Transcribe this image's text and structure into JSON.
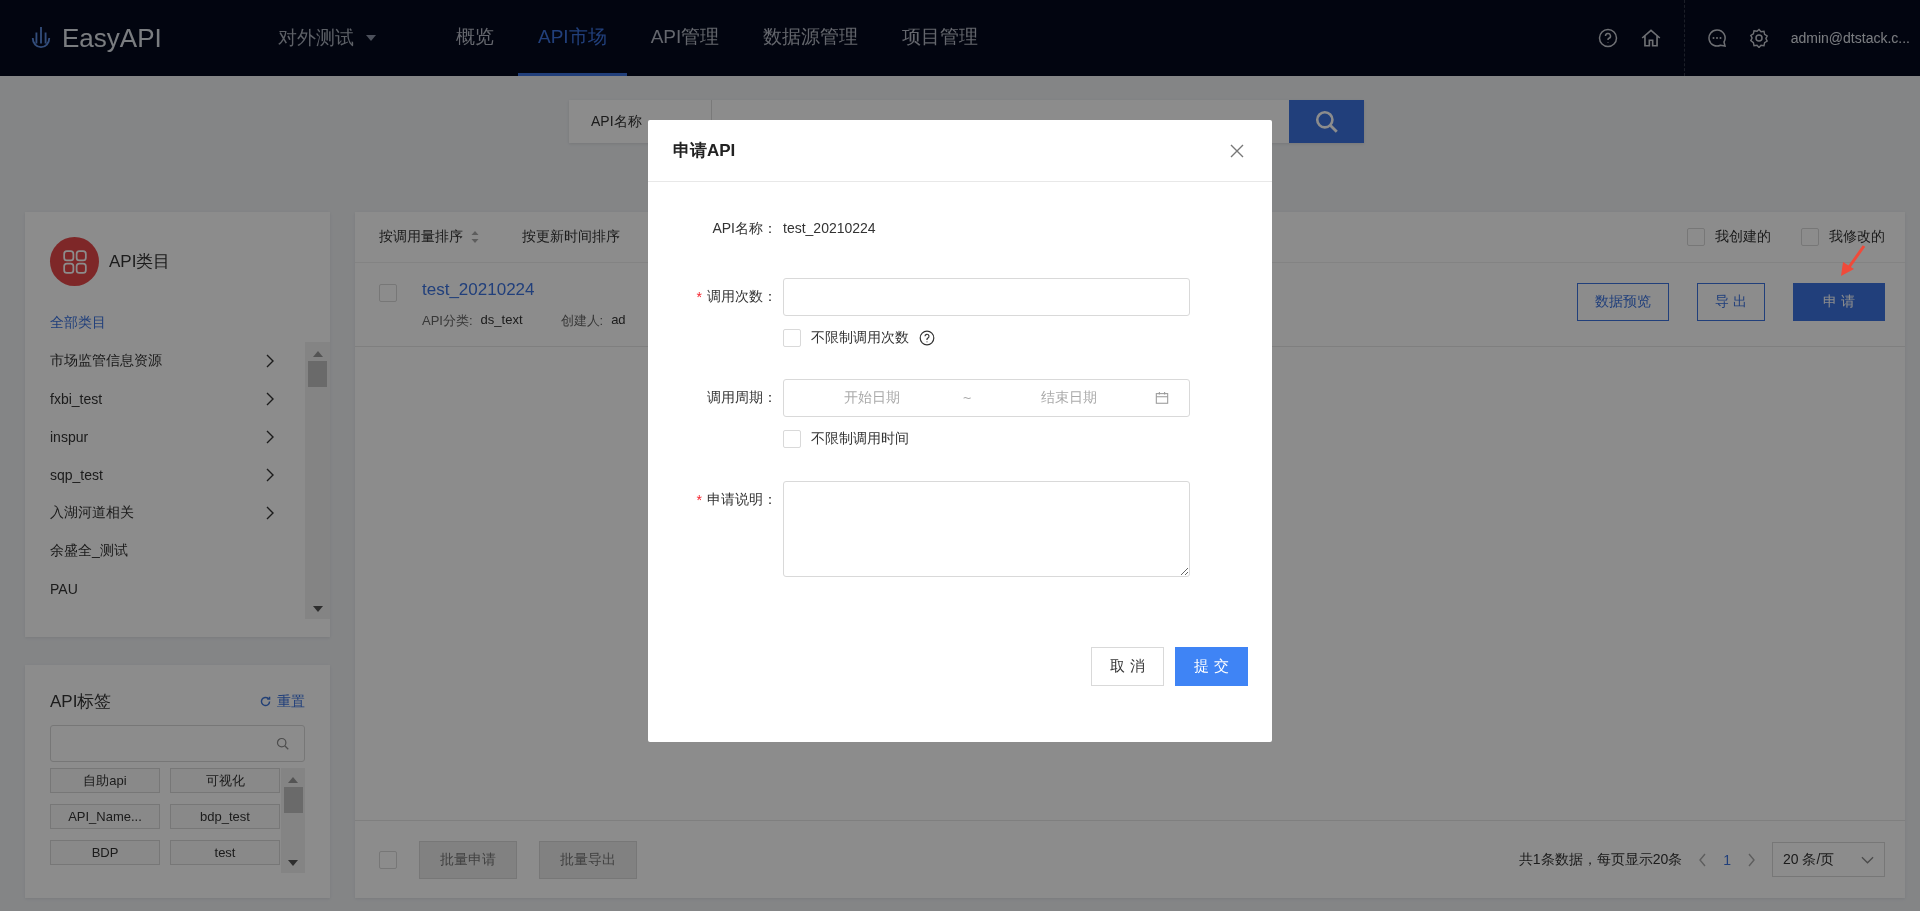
{
  "header": {
    "logo": "EasyAPI",
    "project": "对外测试",
    "project_expanded": false,
    "nav": [
      {
        "label": "概览",
        "selected": false
      },
      {
        "label": "API市场",
        "selected": true
      },
      {
        "label": "API管理",
        "selected": false
      },
      {
        "label": "数据源管理",
        "selected": false
      },
      {
        "label": "项目管理",
        "selected": false
      }
    ],
    "user": "admin@dtstack.c..."
  },
  "search": {
    "field_label": "API名称"
  },
  "categories": {
    "title": "API类目",
    "items": [
      {
        "label": "全部类目",
        "selected": true,
        "has_children": false
      },
      {
        "label": "市场监管信息资源",
        "selected": false,
        "has_children": true
      },
      {
        "label": "fxbi_test",
        "selected": false,
        "has_children": true
      },
      {
        "label": "inspur",
        "selected": false,
        "has_children": true
      },
      {
        "label": "sqp_test",
        "selected": false,
        "has_children": true
      },
      {
        "label": "入湖河道相关",
        "selected": false,
        "has_children": true
      },
      {
        "label": "余盛全_测试",
        "selected": false,
        "has_children": false
      },
      {
        "label": "PAU",
        "selected": false,
        "has_children": false
      }
    ]
  },
  "tags": {
    "title": "API标签",
    "reset": "重置",
    "items": [
      "自助api",
      "可视化",
      "API_Name...",
      "bdp_test",
      "BDP",
      "test"
    ]
  },
  "sort_options": [
    {
      "label": "按调用量排序",
      "sortable": true
    },
    {
      "label": "按更新时间排序",
      "sortable": false
    }
  ],
  "filters": [
    {
      "label": "我创建的",
      "checked": false
    },
    {
      "label": "我修改的",
      "checked": false
    }
  ],
  "apis": [
    {
      "name": "test_20210224",
      "checked": false,
      "category_label": "API分类:",
      "category": "ds_text",
      "creator_label": "创建人:",
      "creator": "ad",
      "actions": [
        {
          "label": "数据预览",
          "primary": false
        },
        {
          "label": "导 出",
          "primary": false
        },
        {
          "label": "申 请",
          "primary": true
        }
      ]
    }
  ],
  "footer": {
    "bulk_checked": false,
    "bulk_actions": [
      {
        "label": "批量申请",
        "disabled": true
      },
      {
        "label": "批量导出",
        "disabled": true
      }
    ],
    "total": "共1条数据，每页显示20条",
    "pages": [
      {
        "label": "1",
        "selected": true
      }
    ],
    "page_size": "20 条/页"
  },
  "modal": {
    "title": "申请API",
    "name_label": "API名称：",
    "name_value": "test_20210224",
    "count_label": "调用次数：",
    "count_required_mark": "*",
    "unlimited_count": {
      "label": "不限制调用次数",
      "checked": false
    },
    "period_label": "调用周期：",
    "start_placeholder": "开始日期",
    "range_separator": "~",
    "end_placeholder": "结束日期",
    "unlimited_time": {
      "label": "不限制调用时间",
      "checked": false
    },
    "reason_label": "申请说明：",
    "reason_required_mark": "*",
    "buttons": [
      {
        "label": "取 消",
        "primary": false
      },
      {
        "label": "提 交",
        "primary": true
      }
    ]
  }
}
